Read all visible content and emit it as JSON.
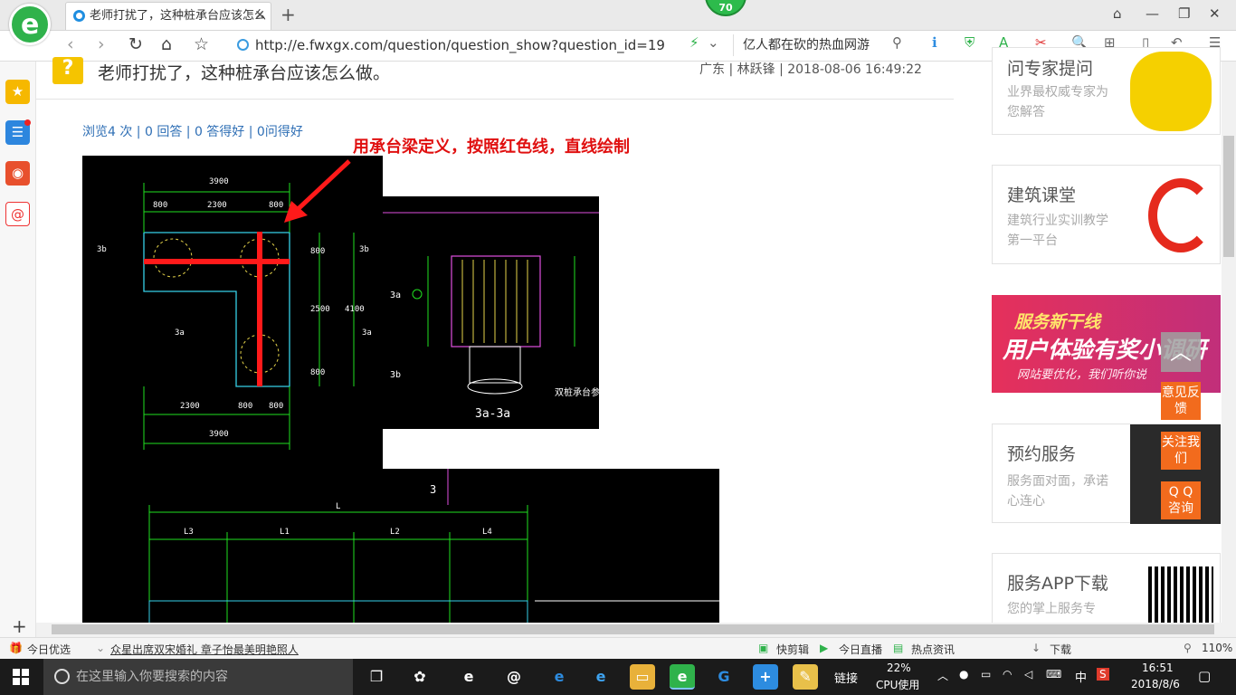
{
  "browser": {
    "tab_title": "老师打扰了，这种桩承台应该怎么",
    "update_badge": "70",
    "url": "http://e.fwxgx.com/question/question_show?question_id=19",
    "hot_search": "亿人都在砍的热血网游",
    "icons": [
      "back-icon",
      "forward-icon",
      "refresh-icon",
      "home-icon",
      "star-icon"
    ]
  },
  "question": {
    "title": "老师打扰了，这种桩承台应该怎么做。",
    "meta": "广东 | 林跃锋 | 2018-08-06 16:49:22",
    "stats": "浏览4 次 | 0 回答 | 0 答得好 | 0问得好",
    "annotation": "用承台梁定义，按照红色线，直线绘制"
  },
  "drawing": {
    "plan_dims_top": [
      "3900",
      "800",
      "2300",
      "800"
    ],
    "plan_dims_bottom": [
      "2300",
      "800",
      "800",
      "3900"
    ],
    "plan_dims_right": [
      "800",
      "2500",
      "800",
      "4100"
    ],
    "labels": [
      "3b",
      "3a",
      "3b",
      "3a",
      "3a",
      "3b"
    ],
    "section_label": "3a-3a",
    "section_note": "双桩承台参",
    "beam_dims": [
      "L",
      "L3",
      "L1",
      "L2",
      "L4"
    ],
    "beam_label": "3"
  },
  "sidebar_cards": [
    {
      "title": "问专家提问",
      "sub": "业界最权威专家为您解答"
    },
    {
      "title": "建筑课堂",
      "sub": "建筑行业实训教学第一平台"
    },
    {
      "title": "预约服务",
      "sub": "服务面对面，承诺心连心"
    },
    {
      "title": "服务APP下载",
      "sub": "您的掌上服务专"
    }
  ],
  "banner": {
    "line1": "服务新干线",
    "line2": "用户体验有奖小调研",
    "line3": "网站要优化，我们听你说"
  },
  "float_buttons": [
    "意见反馈",
    "关注我们",
    "Q Q 咨询"
  ],
  "statusbar": {
    "left_label": "今日优选",
    "news": "众星出席双宋婚礼 章子怡最美明艳照人",
    "right_items": [
      "快剪辑",
      "今日直播",
      "热点资讯",
      "下载",
      "110%"
    ]
  },
  "taskbar": {
    "search_placeholder": "在这里输入你要搜索的内容",
    "link_label": "链接",
    "cpu_percent": "22%",
    "cpu_label": "CPU使用",
    "ime": "中",
    "time": "16:51",
    "date": "2018/8/6"
  },
  "colors": {
    "accent_green": "#2fb24b",
    "annotation_red": "#e01010",
    "float_orange": "#f26b1d"
  }
}
